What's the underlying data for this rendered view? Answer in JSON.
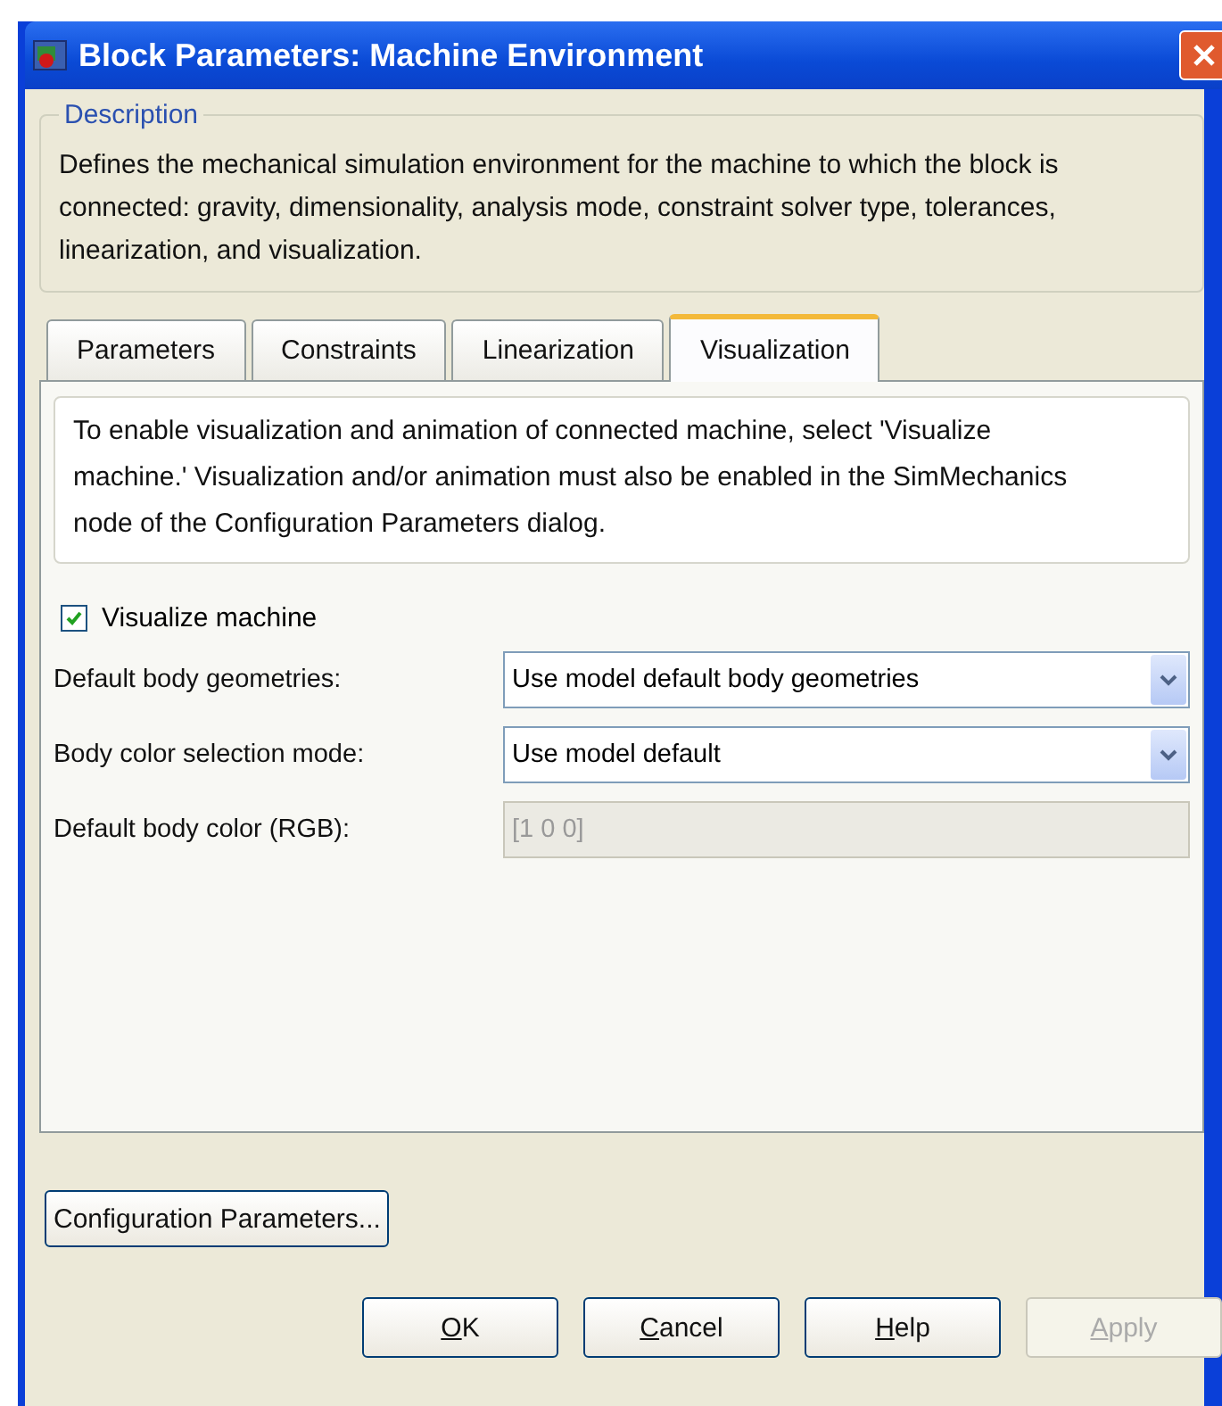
{
  "window": {
    "title": "Block Parameters: Machine Environment"
  },
  "description": {
    "legend": "Description",
    "text": "Defines the mechanical simulation environment for the machine to which the block is connected: gravity, dimensionality, analysis mode, constraint solver type, tolerances, linearization, and visualization."
  },
  "tabs": [
    {
      "label": "Parameters",
      "selected": false
    },
    {
      "label": "Constraints",
      "selected": false
    },
    {
      "label": "Linearization",
      "selected": false
    },
    {
      "label": "Visualization",
      "selected": true
    }
  ],
  "panel": {
    "info": "To enable visualization and animation of connected machine, select 'Visualize machine.' Visualization and/or animation must also be enabled in the SimMechanics node of the Configuration Parameters dialog.",
    "checkbox": {
      "label": "Visualize machine",
      "checked": true
    },
    "fields": [
      {
        "kind": "dropdown",
        "label": "Default body geometries:",
        "value": "Use model default body geometries",
        "disabled": false
      },
      {
        "kind": "dropdown",
        "label": "Body color selection mode:",
        "value": "Use model default",
        "disabled": false
      },
      {
        "kind": "text",
        "label": "Default body color (RGB):",
        "value": "[1 0 0]",
        "disabled": true
      }
    ]
  },
  "config_button": "Configuration Parameters...",
  "buttons": [
    {
      "underlined": "O",
      "after": "K",
      "disabled": false
    },
    {
      "underlined": "C",
      "after": "ancel",
      "disabled": false
    },
    {
      "underlined": "H",
      "after": "elp",
      "disabled": false
    },
    {
      "underlined": "A",
      "after": "pply",
      "disabled": true
    }
  ]
}
